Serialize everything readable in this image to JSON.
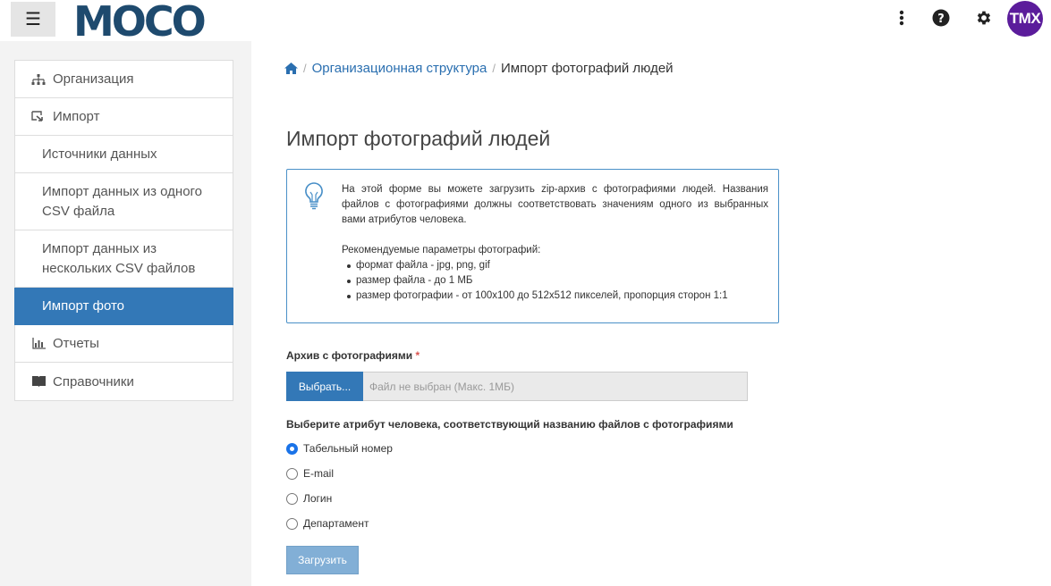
{
  "header": {
    "menu_icon": "hamburger-icon",
    "logo_text": "MOCO",
    "icons": [
      "more-vertical-icon",
      "help-icon",
      "gear-icon"
    ],
    "avatar_initials": "TMX",
    "avatar_color": "#5b1c9b"
  },
  "sidebar": {
    "items": [
      {
        "label": "Организация",
        "icon": "org-structure-icon",
        "level": "top"
      },
      {
        "label": "Импорт",
        "icon": "import-icon",
        "level": "top"
      },
      {
        "label": "Источники данных",
        "level": "sub"
      },
      {
        "label": "Импорт данных из одного CSV файла",
        "level": "sub"
      },
      {
        "label": "Импорт данных из нескольких CSV файлов",
        "level": "sub"
      },
      {
        "label": "Импорт фото",
        "level": "sub",
        "active": true
      },
      {
        "label": "Отчеты",
        "icon": "chart-icon",
        "level": "top"
      },
      {
        "label": "Справочники",
        "icon": "book-icon",
        "level": "top"
      }
    ],
    "active_color": "#3378b7"
  },
  "breadcrumb": {
    "home_icon": "home-icon",
    "items": [
      "Организационная структура",
      "Импорт фотографий людей"
    ]
  },
  "page": {
    "title": "Импорт фотографий людей"
  },
  "info": {
    "icon": "lightbulb-icon",
    "paragraph": "На этой форме вы можете загрузить zip-архив с фотографиями людей. Названия файлов с фотографиями должны соответствовать значениям одного из выбранных вами атрибутов человека.",
    "params_title": "Рекомендуемые параметры фотографий:",
    "params": [
      "формат файла - jpg, png, gif",
      "размер файла - до 1 МБ",
      "размер фотографии - от 100х100 до 512х512 пикселей, пропорция сторон 1:1"
    ]
  },
  "form": {
    "archive_label": "Архив с фотографиями",
    "required_mark": "*",
    "choose_button": "Выбрать...",
    "file_placeholder": "Файл не выбран (Макс. 1МБ)",
    "attribute_label": "Выберите атрибут человека, соответствующий названию файлов с фотографиями",
    "options": [
      "Табельный номер",
      "E-mail",
      "Логин",
      "Департамент"
    ],
    "selected_option": "Табельный номер",
    "submit_button": "Загрузить"
  }
}
